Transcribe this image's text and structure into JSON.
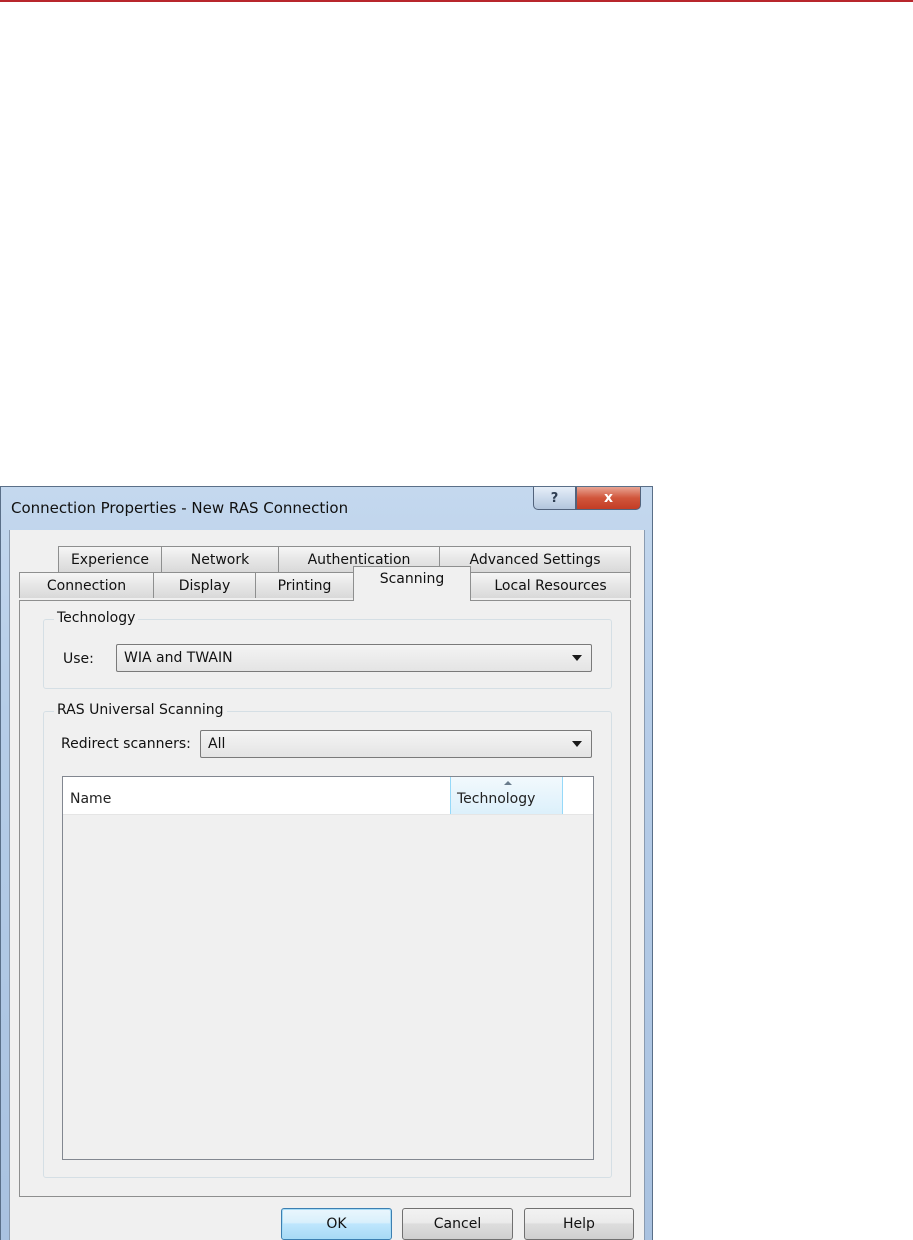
{
  "window": {
    "title": "Connection Properties - New RAS Connection",
    "help_glyph": "?",
    "close_glyph": "x"
  },
  "tabs": {
    "row_back": [
      {
        "label": "Experience"
      },
      {
        "label": "Network"
      },
      {
        "label": "Authentication"
      },
      {
        "label": "Advanced Settings"
      }
    ],
    "row_front": [
      {
        "label": "Connection"
      },
      {
        "label": "Display"
      },
      {
        "label": "Printing"
      },
      {
        "label": "Scanning",
        "selected": true
      },
      {
        "label": "Local Resources"
      }
    ]
  },
  "technology": {
    "group_label": "Technology",
    "use_label": "Use:",
    "use_value": "WIA and TWAIN"
  },
  "universal_scanning": {
    "group_label": "RAS Universal Scanning",
    "redirect_label": "Redirect scanners:",
    "redirect_value": "All",
    "columns": [
      "Name",
      "Technology"
    ],
    "rows": []
  },
  "buttons": {
    "ok": "OK",
    "cancel": "Cancel",
    "help": "Help"
  },
  "colors": {
    "accent_rule": "#b8262c",
    "close_button": "#c33d25",
    "default_button_border": "#3c7fb1"
  }
}
